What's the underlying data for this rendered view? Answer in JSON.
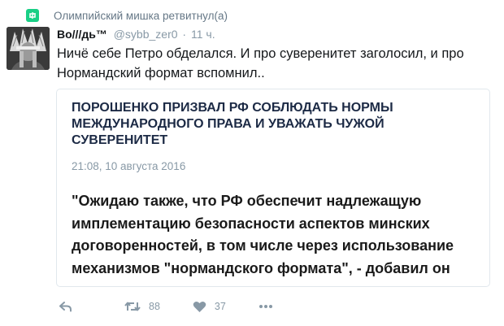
{
  "retweet_notice": {
    "icon": "retweet-icon",
    "text": "Олимпийский мишка ретвитнул(а)"
  },
  "tweet": {
    "author_name": "Во///дь™",
    "handle": "@sybb_zer0",
    "separator": "·",
    "time": "11 ч.",
    "text": "Ничё себе Петро обделался. И про суверенитет заголосил, и про Нормандский формат вспомнил..",
    "card": {
      "title": "ПОРОШЕНКО ПРИЗВАЛ РФ СОБЛЮДАТЬ НОРМЫ МЕЖДУНАРОДНОГО ПРАВА И УВАЖАТЬ ЧУЖОЙ СУВЕРЕНИТЕТ",
      "date": "21:08, 10 августа 2016",
      "quote": "\"Ожидаю также, что РФ обеспечит надлежащую имплементацию безопасности аспектов минских договоренностей, в том числе через использование механизмов \"нормандского формата\", - добавил он"
    },
    "actions": {
      "retweet_count": "88",
      "like_count": "37"
    }
  },
  "colors": {
    "retweet_green": "#19cf86",
    "muted": "#8899a6",
    "card_title": "#1c2a45"
  }
}
